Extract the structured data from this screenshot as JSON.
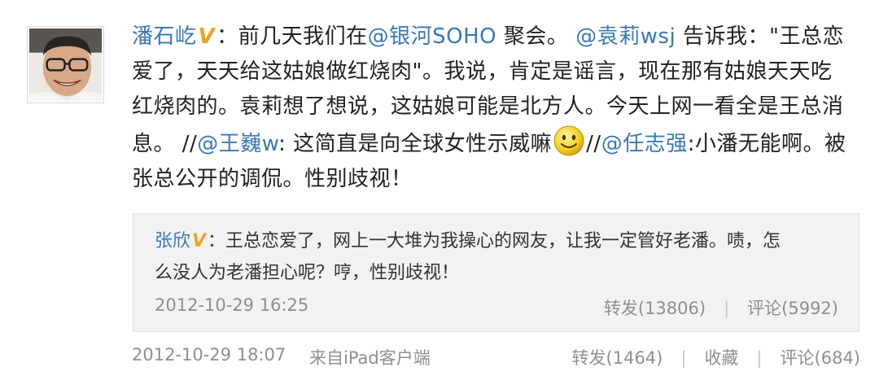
{
  "post": {
    "author": "潘石屹",
    "line1_a": "：前几天我们在",
    "mention_soho": "@银河SOHO",
    "line1_b": " 聚会。",
    "mention_yuanli": "@袁莉wsj",
    "line1_c": " 告诉我：\"王总恋",
    "line2": "爱了，天天给这姑娘做红烧肉\"。我说，肯定是谣言，现在那有姑娘天天吃",
    "line3": "红烧肉的。袁莉想了想说，这姑娘可能是北方人。今天上网一看全是王总消",
    "line4_a": "息。 //",
    "mention_wangwei": "@王巍w",
    "line4_b": ": 这简直是向全球女性示威嘛",
    "line4_c": "//",
    "mention_renzhiqiang": "@任志强",
    "line4_d": ":小潘无能啊。被",
    "line5": "张总公开的调侃。性别歧视！"
  },
  "repost": {
    "author": "张欣",
    "text_line1": "：王总恋爱了，网上一大堆为我操心的网友，让我一定管好老潘。啧，怎",
    "text_line2": "么没人为老潘担心呢？哼，性别歧视！",
    "time": "2012-10-29 16:25",
    "forward_label": "转发(13806)",
    "separator": "|",
    "comment_label": "评论(5992)"
  },
  "footer": {
    "time": "2012-10-29 18:07",
    "source": "来自iPad客户端",
    "forward_label": "转发(1464)",
    "separator": "|",
    "favorite_label": "收藏",
    "comment_label": "评论(684)"
  },
  "badges": {
    "verified_symbol": "V"
  },
  "icons": {
    "smiley": "smiley-emoticon-icon",
    "verified": "verified-v-badge-icon"
  },
  "colors": {
    "link": "#3a78b8",
    "text": "#222222",
    "meta": "#8f8f8f",
    "verified_badge": "#f0a21e",
    "repost_bg": "#f2f2f2"
  }
}
